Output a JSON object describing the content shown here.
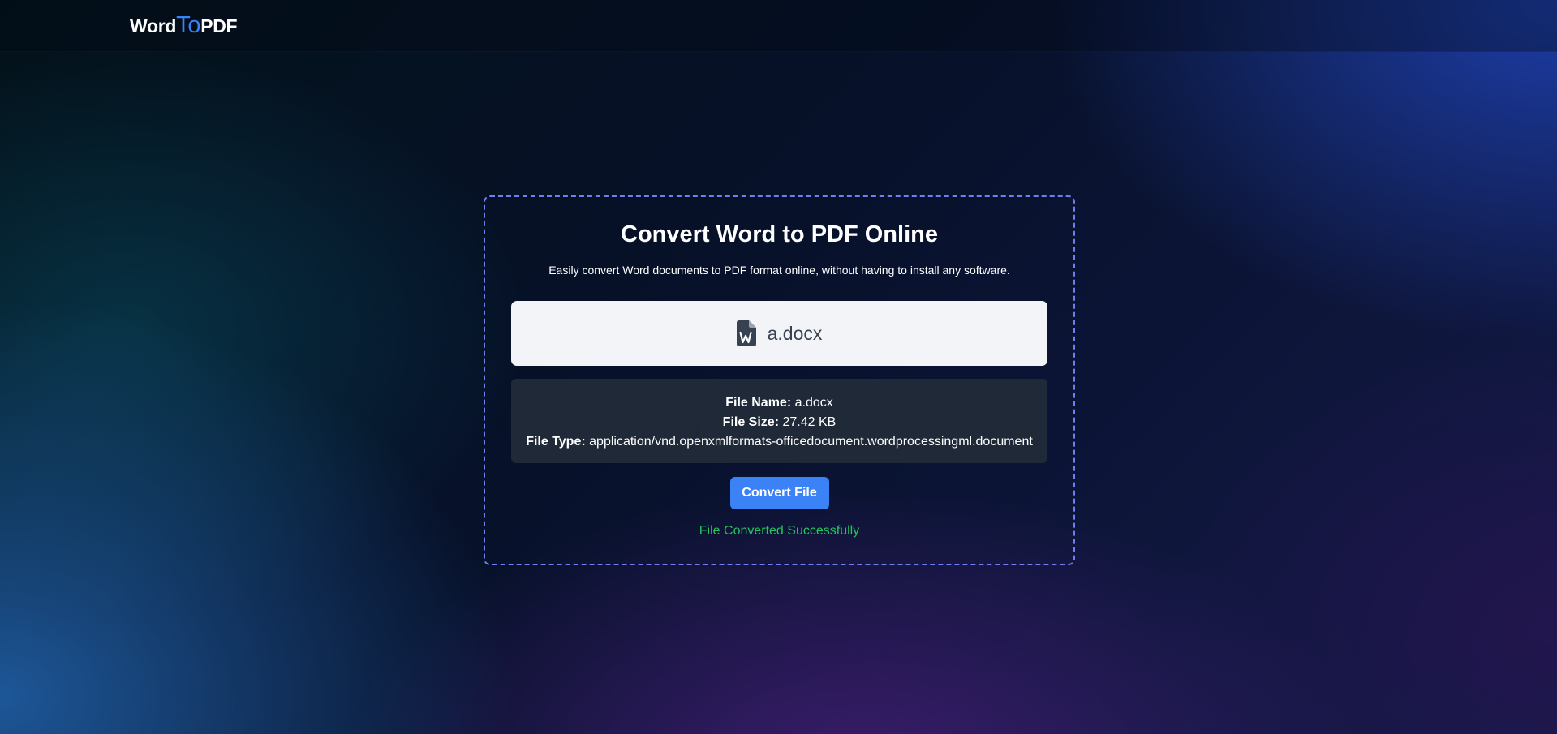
{
  "header": {
    "logo": {
      "part1": "Word",
      "part2": "To",
      "part3": "PDF"
    }
  },
  "main": {
    "title": "Convert Word to PDF Online",
    "subtitle": "Easily convert Word documents to PDF format online, without having to install any software.",
    "file_drop": {
      "icon": "word-file-icon",
      "file_name": "a.docx"
    },
    "file_info": {
      "name_label": "File Name:",
      "name_value": "a.docx",
      "size_label": "File Size:",
      "size_value": "27.42 KB",
      "type_label": "File Type:",
      "type_value": "application/vnd.openxmlformats-officedocument.wordprocessingml.document"
    },
    "convert_button": "Convert File",
    "status": "File Converted Successfully"
  },
  "colors": {
    "accent": "#3b82f6",
    "success": "#22c55e",
    "card_border": "#6f7ff0",
    "info_bg": "#1f2937",
    "file_box_bg": "#f2f4f7"
  }
}
